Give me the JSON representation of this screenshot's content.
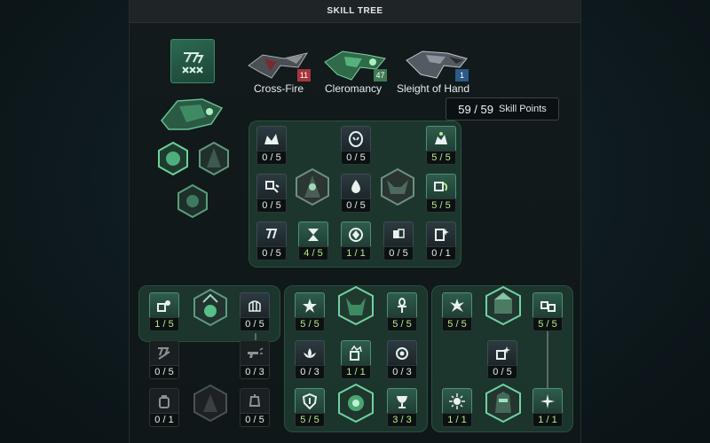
{
  "title": "SKILL TREE",
  "weapons": [
    {
      "name": "Cross-Fire",
      "level": "11",
      "badge_color": "#a8343c"
    },
    {
      "name": "Cleromancy",
      "level": "47",
      "badge_color": "#3f7a52"
    },
    {
      "name": "Sleight of Hand",
      "level": "1",
      "badge_color": "#2c5a8a"
    }
  ],
  "skill_points": {
    "value": "59 / 59",
    "label": "Skill Points"
  },
  "main_tree": [
    {
      "count": "0 / 5",
      "state": "normal",
      "icon": "flame-crown-icon"
    },
    {
      "count": "0 / 5",
      "state": "normal",
      "icon": "mask-icon"
    },
    {
      "count": "5 / 5",
      "state": "active",
      "icon": "crown-flame-icon"
    },
    {
      "count": "0 / 5",
      "state": "normal",
      "icon": "dice-shards-icon"
    },
    {
      "count": "0 / 5",
      "state": "normal",
      "icon": "drop-icon"
    },
    {
      "count": "5 / 5",
      "state": "active",
      "icon": "dice-leaf-icon"
    },
    {
      "count": "0 / 5",
      "state": "normal",
      "icon": "claw-mark-icon"
    },
    {
      "count": "4 / 5",
      "state": "active",
      "icon": "hourglass-icon"
    },
    {
      "count": "1 / 1",
      "state": "active",
      "icon": "gem-target-icon"
    },
    {
      "count": "0 / 5",
      "state": "normal",
      "icon": "hand-cards-icon"
    },
    {
      "count": "0 / 1",
      "state": "normal",
      "icon": "card-sparkle-icon"
    }
  ],
  "left_tree": [
    {
      "count": "1 / 5",
      "state": "active",
      "icon": "dice-bomb-icon"
    },
    {
      "count": "0 / 5",
      "state": "normal",
      "icon": "cage-icon"
    },
    {
      "count": "0 / 5",
      "state": "locked",
      "icon": "dice-slash-icon"
    },
    {
      "count": "0 / 3",
      "state": "locked",
      "icon": "pistol-burst-icon"
    },
    {
      "count": "0 / 1",
      "state": "locked",
      "icon": "grenade-icon"
    },
    {
      "count": "0 / 5",
      "state": "locked",
      "icon": "lantern-icon"
    }
  ],
  "mid_tree": [
    {
      "count": "5 / 5",
      "state": "active",
      "icon": "spike-star-icon"
    },
    {
      "count": "5 / 5",
      "state": "active",
      "icon": "ankh-icon"
    },
    {
      "count": "0 / 3",
      "state": "normal",
      "icon": "lotus-icon"
    },
    {
      "count": "1 / 1",
      "state": "active",
      "icon": "dice-crown-icon"
    },
    {
      "count": "0 / 3",
      "state": "normal",
      "icon": "ring-orb-icon"
    },
    {
      "count": "5 / 5",
      "state": "active",
      "icon": "shield-sigil-icon"
    },
    {
      "count": "3 / 3",
      "state": "active",
      "icon": "chalice-icon"
    }
  ],
  "right_tree": [
    {
      "count": "5 / 5",
      "state": "active",
      "icon": "shatter-icon"
    },
    {
      "count": "5 / 5",
      "state": "active",
      "icon": "dice-pair-icon"
    },
    {
      "count": "0 / 5",
      "state": "normal",
      "icon": "sparkle-dice-icon"
    },
    {
      "count": "1 / 1",
      "state": "active",
      "icon": "star-burst-icon"
    },
    {
      "count": "1 / 1",
      "state": "active",
      "icon": "nova-icon"
    }
  ],
  "colors": {
    "accent_green": "#b9ec8a",
    "region": "#264e3e",
    "panel": "#121a1c"
  }
}
